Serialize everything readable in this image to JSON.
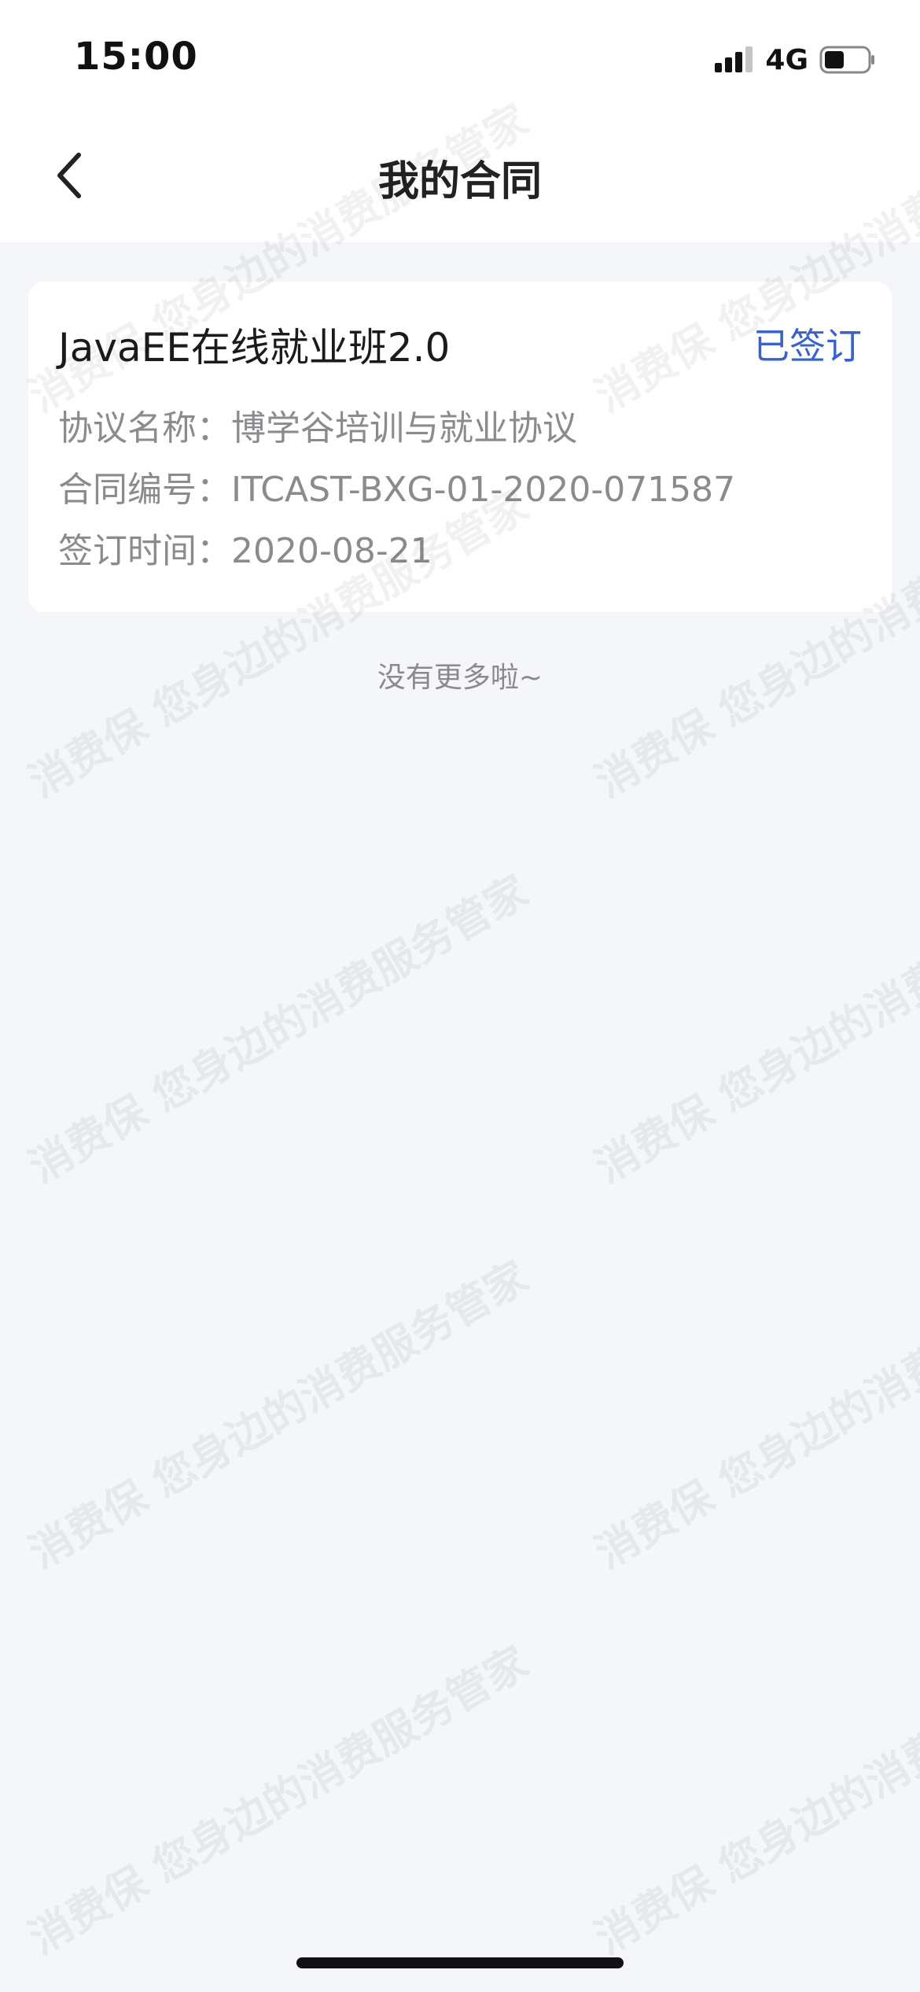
{
  "status_bar": {
    "time": "15:00",
    "network": "4G"
  },
  "nav": {
    "title": "我的合同",
    "back_icon": "chevron-left-icon"
  },
  "contract": {
    "name": "JavaEE在线就业班2.0",
    "status": "已签订",
    "status_color": "#3a63c8",
    "rows": [
      {
        "label": "协议名称：",
        "value": "博学谷培训与就业协议"
      },
      {
        "label": "合同编号：",
        "value": "ITCAST-BXG-01-2020-071587"
      },
      {
        "label": "签订时间：",
        "value": "2020-08-21"
      }
    ]
  },
  "footer": {
    "no_more": "没有更多啦~"
  },
  "watermark": {
    "text_a": "消费保 您身边的消费服务管家"
  },
  "colors": {
    "page_bg": "#f5f6fa",
    "card_bg": "#ffffff",
    "accent": "#3a63c8"
  }
}
